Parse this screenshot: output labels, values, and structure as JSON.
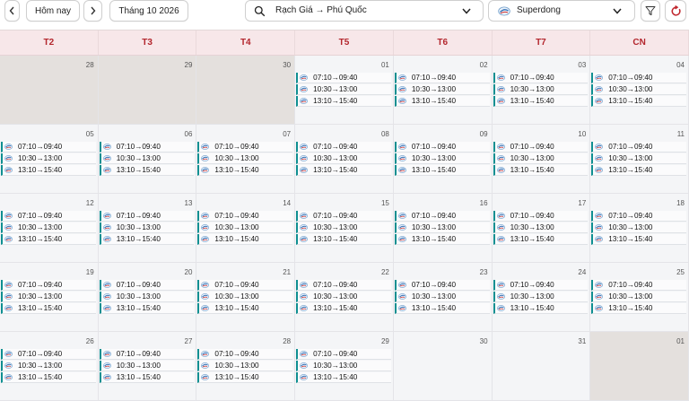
{
  "toolbar": {
    "today_label": "Hôm nay",
    "month_label": "Tháng 10 2026",
    "route_label": "Rạch Giá → Phú Quốc",
    "operator_label": "Superdong"
  },
  "colors": {
    "accent": "#b3262d",
    "trip_border": "#0f8f91",
    "header_bg": "#f7e7e9",
    "muted_cell": "#e4e0dd"
  },
  "weekdays": [
    "T2",
    "T3",
    "T4",
    "T5",
    "T6",
    "T7",
    "CN"
  ],
  "trip_times": [
    "07:10→09:40",
    "10:30→13:00",
    "13:10→15:40"
  ],
  "days": [
    {
      "n": "28",
      "muted": true,
      "trips": false
    },
    {
      "n": "29",
      "muted": true,
      "trips": false
    },
    {
      "n": "30",
      "muted": true,
      "trips": false
    },
    {
      "n": "01",
      "muted": false,
      "trips": true
    },
    {
      "n": "02",
      "muted": false,
      "trips": true
    },
    {
      "n": "03",
      "muted": false,
      "trips": true
    },
    {
      "n": "04",
      "muted": false,
      "trips": true
    },
    {
      "n": "05",
      "muted": false,
      "trips": true
    },
    {
      "n": "06",
      "muted": false,
      "trips": true
    },
    {
      "n": "07",
      "muted": false,
      "trips": true
    },
    {
      "n": "08",
      "muted": false,
      "trips": true
    },
    {
      "n": "09",
      "muted": false,
      "trips": true
    },
    {
      "n": "10",
      "muted": false,
      "trips": true
    },
    {
      "n": "11",
      "muted": false,
      "trips": true
    },
    {
      "n": "12",
      "muted": false,
      "trips": true
    },
    {
      "n": "13",
      "muted": false,
      "trips": true
    },
    {
      "n": "14",
      "muted": false,
      "trips": true
    },
    {
      "n": "15",
      "muted": false,
      "trips": true
    },
    {
      "n": "16",
      "muted": false,
      "trips": true
    },
    {
      "n": "17",
      "muted": false,
      "trips": true
    },
    {
      "n": "18",
      "muted": false,
      "trips": true
    },
    {
      "n": "19",
      "muted": false,
      "trips": true
    },
    {
      "n": "20",
      "muted": false,
      "trips": true
    },
    {
      "n": "21",
      "muted": false,
      "trips": true
    },
    {
      "n": "22",
      "muted": false,
      "trips": true
    },
    {
      "n": "23",
      "muted": false,
      "trips": true
    },
    {
      "n": "24",
      "muted": false,
      "trips": true
    },
    {
      "n": "25",
      "muted": false,
      "trips": true
    },
    {
      "n": "26",
      "muted": false,
      "trips": true
    },
    {
      "n": "27",
      "muted": false,
      "trips": true
    },
    {
      "n": "28",
      "muted": false,
      "trips": true
    },
    {
      "n": "29",
      "muted": false,
      "trips": true
    },
    {
      "n": "30",
      "muted": false,
      "trips": false
    },
    {
      "n": "31",
      "muted": false,
      "trips": false
    },
    {
      "n": "01",
      "muted": true,
      "trips": false
    }
  ]
}
